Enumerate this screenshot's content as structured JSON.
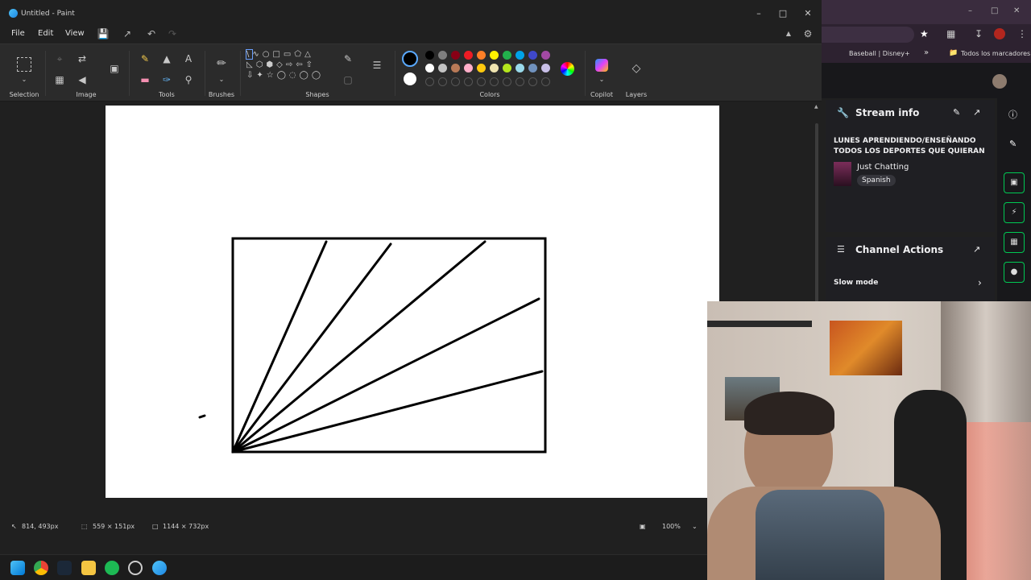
{
  "paint": {
    "window_title": "Untitled - Paint",
    "menu": {
      "file": "File",
      "edit": "Edit",
      "view": "View"
    },
    "ribbon_groups": {
      "selection": "Selection",
      "image": "Image",
      "tools": "Tools",
      "brushes": "Brushes",
      "shapes": "Shapes",
      "colors": "Colors",
      "copilot": "Copilot",
      "layers": "Layers"
    },
    "palette_row1": [
      "#000000",
      "#7f7f7f",
      "#880015",
      "#ed1c24",
      "#ff7f27",
      "#fff200",
      "#22b14c",
      "#00a2e8",
      "#3f48cc",
      "#a349a4"
    ],
    "palette_row2": [
      "#ffffff",
      "#c3c3c3",
      "#b97a57",
      "#ffaec9",
      "#ffc90e",
      "#efe4b0",
      "#b5e61d",
      "#99d9ea",
      "#7092be",
      "#c8bfe7"
    ],
    "status": {
      "cursor_pos": "814, 493px",
      "selection_size": "559 × 151px",
      "canvas_size": "1144 × 732px",
      "zoom": "100%"
    }
  },
  "browser": {
    "bookmark_1": "Baseball | Disney+",
    "bookmark_chevron": "»",
    "bookmark_all": "Todos los marcadores"
  },
  "twitch": {
    "stream_info": {
      "header": "Stream info",
      "title": "LUNES APRENDIENDO/ENSEÑANDO TODOS LOS DEPORTES QUE QUIERAN",
      "category": "Just Chatting",
      "tag": "Spanish"
    },
    "channel_actions": {
      "header": "Channel Actions",
      "slow_mode": "Slow mode"
    }
  }
}
